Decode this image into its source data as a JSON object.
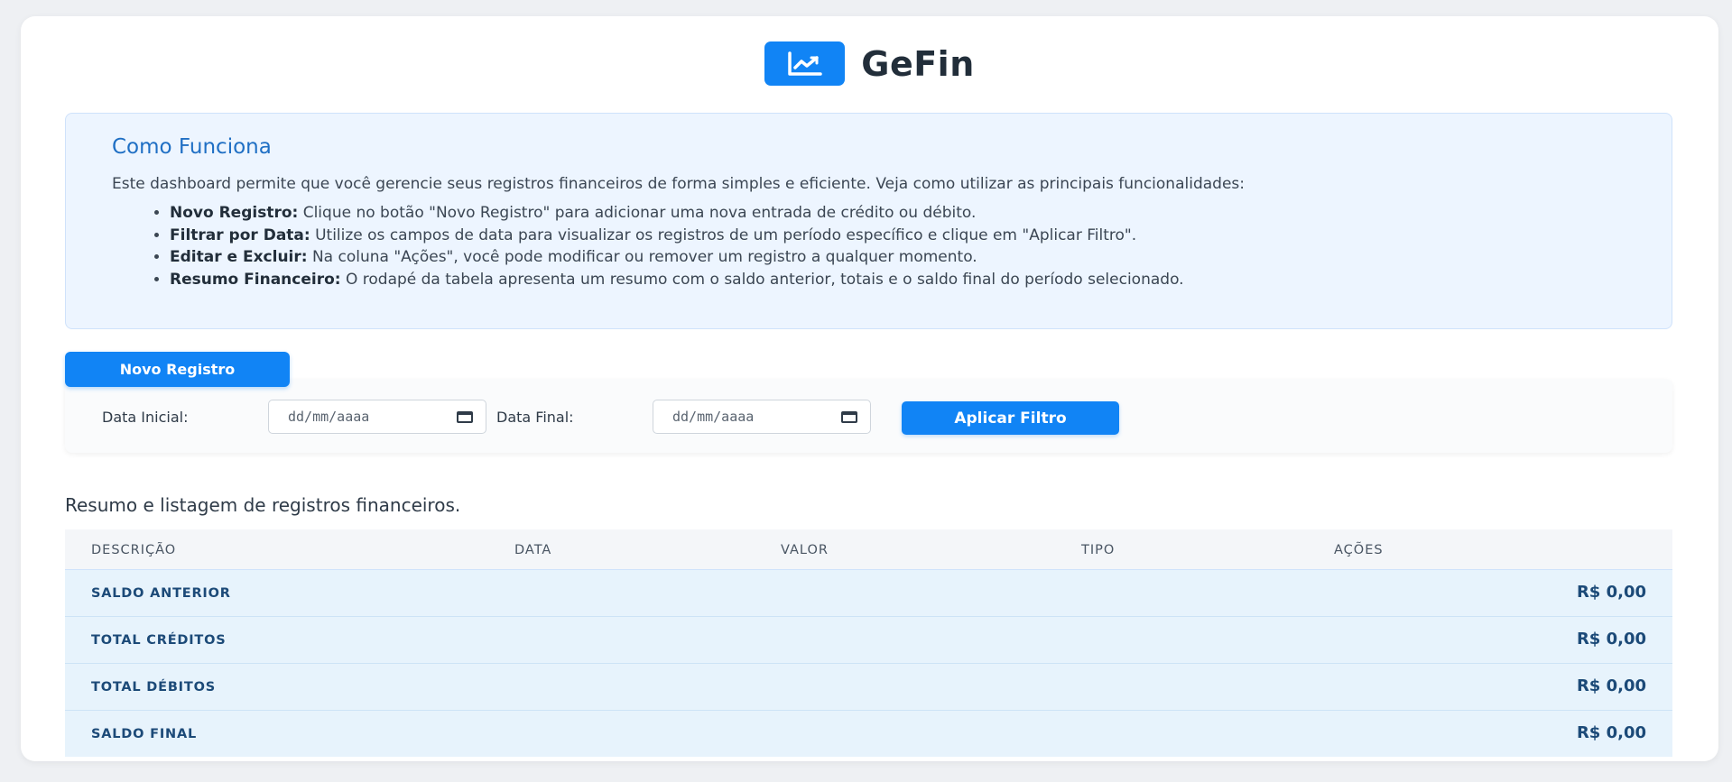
{
  "brand": {
    "name": "GeFin",
    "logo_icon": "line-chart-icon",
    "accent_color": "#1184f5"
  },
  "info": {
    "title": "Como Funciona",
    "intro": "Este dashboard permite que você gerencie seus registros financeiros de forma simples e eficiente. Veja como utilizar as principais funcionalidades:",
    "items": [
      {
        "term": "Novo Registro:",
        "text": " Clique no botão \"Novo Registro\" para adicionar uma nova entrada de crédito ou débito."
      },
      {
        "term": "Filtrar por Data:",
        "text": " Utilize os campos de data para visualizar os registros de um período específico e clique em \"Aplicar Filtro\"."
      },
      {
        "term": "Editar e Excluir:",
        "text": " Na coluna \"Ações\", você pode modificar ou remover um registro a qualquer momento."
      },
      {
        "term": "Resumo Financeiro:",
        "text": " O rodapé da tabela apresenta um resumo com o saldo anterior, totais e o saldo final do período selecionado."
      }
    ]
  },
  "actions": {
    "new_record": "Novo Registro"
  },
  "filter": {
    "start_label": "Data Inicial:",
    "start_placeholder": "dd/mm/aaaa",
    "end_label": "Data Final:",
    "end_placeholder": "dd/mm/aaaa",
    "apply_label": "Aplicar Filtro"
  },
  "table": {
    "caption": "Resumo e listagem de registros financeiros.",
    "columns": [
      "DESCRIÇÃO",
      "DATA",
      "VALOR",
      "TIPO",
      "AÇÕES"
    ],
    "summary": [
      {
        "label": "SALDO ANTERIOR",
        "value": "R$ 0,00"
      },
      {
        "label": "TOTAL CRÉDITOS",
        "value": "R$ 0,00"
      },
      {
        "label": "TOTAL DÉBITOS",
        "value": "R$ 0,00"
      },
      {
        "label": "SALDO FINAL",
        "value": "R$ 0,00"
      }
    ]
  }
}
